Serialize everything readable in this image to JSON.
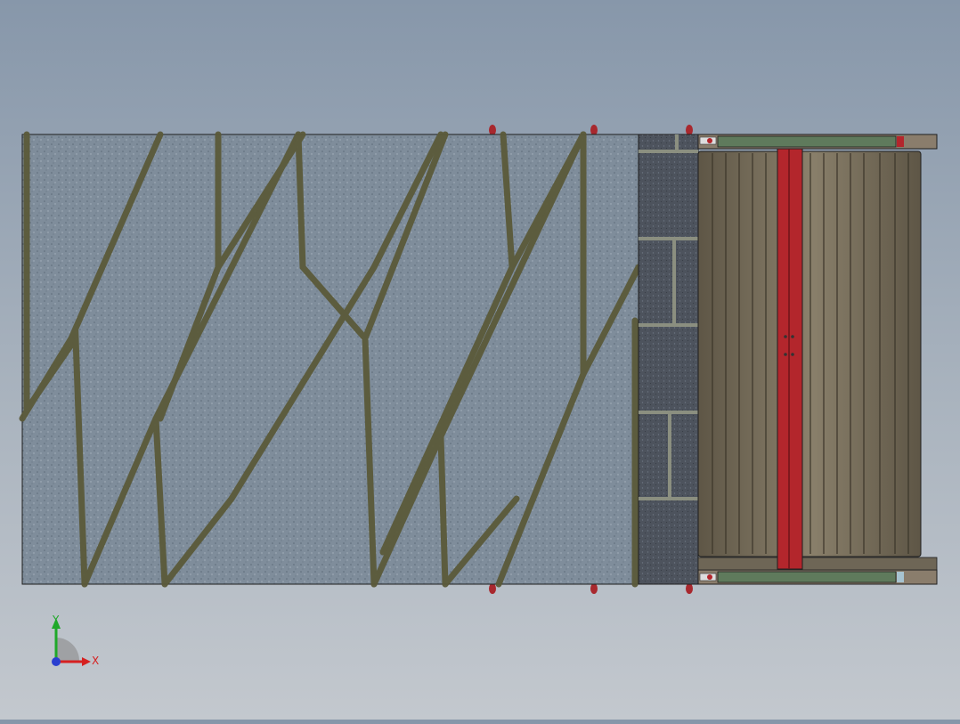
{
  "viewport": {
    "background_top": "#8797aa",
    "background_bottom": "#c3c8ce"
  },
  "model": {
    "belt_surface_color": "#7d8c99",
    "belt_groove_color": "#5b5a3a",
    "tile_color": "#4f5560",
    "roller_color": "#7b715d",
    "frame_rail_color": "#5f7a5c",
    "crossbar_color": "#b3262c",
    "bolt_color": "#a8282e"
  },
  "triad": {
    "x_label": "X",
    "y_label": "Y",
    "x_color": "#d62020",
    "y_color": "#1fa829",
    "z_color": "#2a3fd0"
  }
}
